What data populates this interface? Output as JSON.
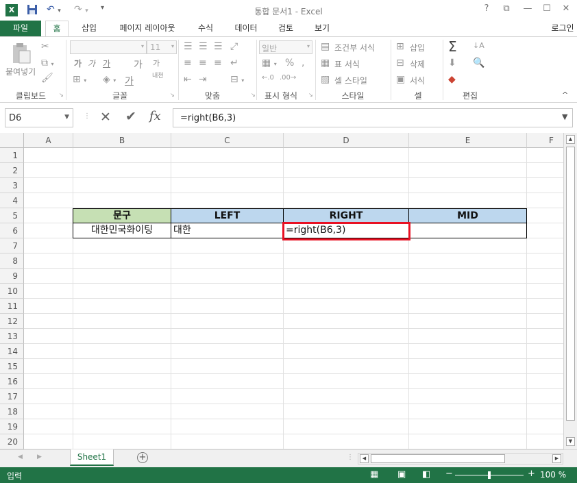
{
  "title": "통합 문서1 - Excel",
  "window_buttons": {
    "help": "?",
    "ribbon_display": "⧉",
    "minimize": "—",
    "maximize": "☐",
    "close": "✕"
  },
  "tabs": [
    {
      "label": "파일"
    },
    {
      "label": "홈"
    },
    {
      "label": "삽입"
    },
    {
      "label": "페이지 레이아웃"
    },
    {
      "label": "수식"
    },
    {
      "label": "데이터"
    },
    {
      "label": "검토"
    },
    {
      "label": "보기"
    }
  ],
  "account": "로그인",
  "ribbon": {
    "clipboard": {
      "paste": "붙여넣기",
      "label": "클립보드"
    },
    "font": {
      "size": "11",
      "label": "글꼴",
      "bold": "가",
      "italic": "가",
      "underline": "가",
      "grow": "가",
      "shrink": "가",
      "fontcolor": "가",
      "phonetic": "내천"
    },
    "alignment": {
      "label": "맞춤"
    },
    "number": {
      "format": "일반",
      "label": "표시 형식"
    },
    "styles": {
      "conditional": "조건부 서식",
      "table": "표 서식",
      "cell": "셀 스타일",
      "label": "스타일"
    },
    "cells": {
      "insert": "삽입",
      "delete": "삭제",
      "format": "서식",
      "label": "셀"
    },
    "editing": {
      "label": "편집"
    }
  },
  "formula_bar": {
    "name_box": "D6",
    "formula": "=right(B6,3)",
    "fx": "fx"
  },
  "columns": [
    "A",
    "B",
    "C",
    "D",
    "E",
    "F"
  ],
  "rows": [
    "1",
    "2",
    "3",
    "4",
    "5",
    "6",
    "7",
    "8",
    "9",
    "10",
    "11",
    "12",
    "13",
    "14",
    "15",
    "16",
    "17",
    "18",
    "19",
    "20"
  ],
  "cells": {
    "B5": "문구",
    "C5": "LEFT",
    "D5": "RIGHT",
    "E5": "MID",
    "B6": "대한민국화이팅",
    "C6": "대한",
    "D6": "=right(B6,3)",
    "E6": ""
  },
  "colors": {
    "accent": "#217346",
    "header_green": "#c6e0b4",
    "header_blue": "#bdd7ee",
    "selection": "#e81123"
  },
  "sheets": [
    {
      "label": "Sheet1"
    }
  ],
  "status": {
    "mode": "입력",
    "zoom": "100 %"
  }
}
